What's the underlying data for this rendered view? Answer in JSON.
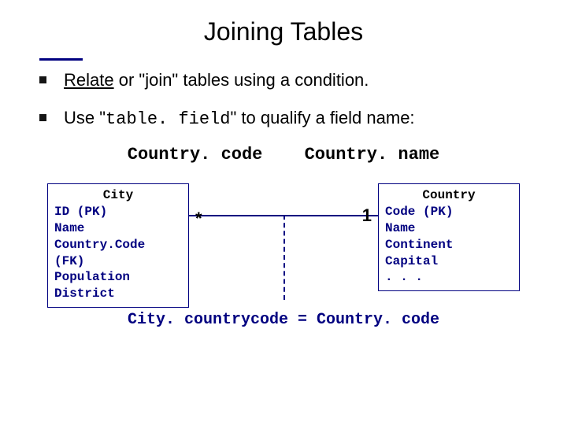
{
  "title": "Joining Tables",
  "bullets": {
    "b1_pre": "Relate",
    "b1_post": " or \"join\" tables using a condition.",
    "b2_pre": "Use \"",
    "b2_code": "table. field",
    "b2_post": "\" to qualify a field name:"
  },
  "examples": {
    "ex1": "Country. code",
    "ex2": "Country. name"
  },
  "entities": {
    "city": {
      "name": "City",
      "f1": "ID (PK)",
      "f2": "Name",
      "f3": "Country.Code (FK)",
      "f4": "Population",
      "f5": "District"
    },
    "country": {
      "name": "Country",
      "f1": "Code (PK)",
      "f2": "Name",
      "f3": "Continent",
      "f4": "Capital",
      "f5": ". . ."
    }
  },
  "relationship": {
    "left_card": "*",
    "right_card": "1",
    "condition": "City. countrycode = Country. code"
  }
}
